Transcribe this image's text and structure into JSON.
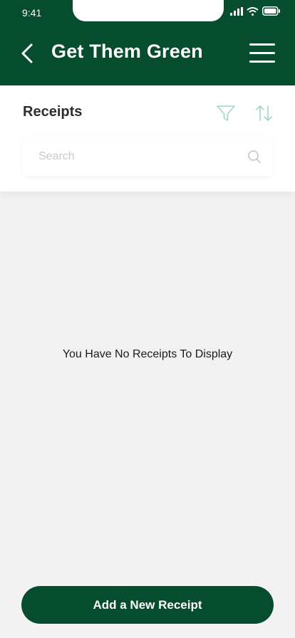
{
  "status_bar": {
    "time": "9:41"
  },
  "header": {
    "title": "Get Them Green",
    "back_icon": "chevron-left-icon",
    "menu_icon": "hamburger-menu-icon"
  },
  "receipts": {
    "section_title": "Receipts",
    "filter_icon": "filter-icon",
    "sort_icon": "sort-arrows-icon",
    "search": {
      "placeholder": "Search",
      "value": ""
    },
    "empty_message": "You Have No Receipts To Display"
  },
  "footer": {
    "add_button_label": "Add a New Receipt"
  },
  "colors": {
    "brand": "#064d2f",
    "accent_icon": "#9fd7c6",
    "background": "#f2f2f2"
  }
}
